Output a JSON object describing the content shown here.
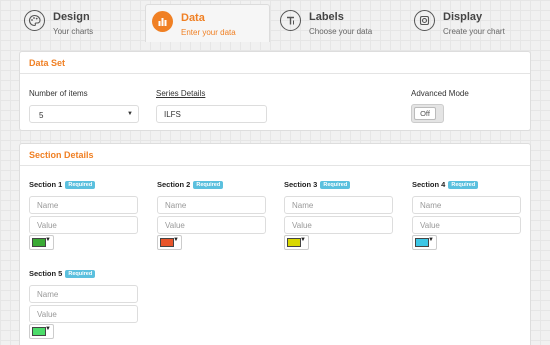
{
  "tabs": [
    {
      "title": "Design",
      "subtitle": "Your charts",
      "icon": "palette-icon",
      "active": false
    },
    {
      "title": "Data",
      "subtitle": "Enter your data",
      "icon": "bar-chart-icon",
      "active": true
    },
    {
      "title": "Labels",
      "subtitle": "Choose your data",
      "icon": "text-icon",
      "active": false
    },
    {
      "title": "Display",
      "subtitle": "Create your chart",
      "icon": "display-icon",
      "active": false
    }
  ],
  "data_set": {
    "heading": "Data Set",
    "items_label": "Number of items",
    "items_value": "5",
    "series_label": "Series Details",
    "series_value": "ILFS",
    "advanced_label": "Advanced Mode",
    "advanced_value": "Off"
  },
  "section_details": {
    "heading": "Section Details",
    "required_badge": "Required",
    "name_placeholder": "Name",
    "value_placeholder": "Value",
    "sections": [
      {
        "title": "Section 1",
        "color": "#3aaa35"
      },
      {
        "title": "Section 2",
        "color": "#e8542a"
      },
      {
        "title": "Section 3",
        "color": "#d9d800"
      },
      {
        "title": "Section 4",
        "color": "#3cc7e6"
      },
      {
        "title": "Section 5",
        "color": "#4cdc6a"
      }
    ]
  },
  "colors": {
    "accent": "#f08024",
    "badge": "#5bc0de"
  }
}
